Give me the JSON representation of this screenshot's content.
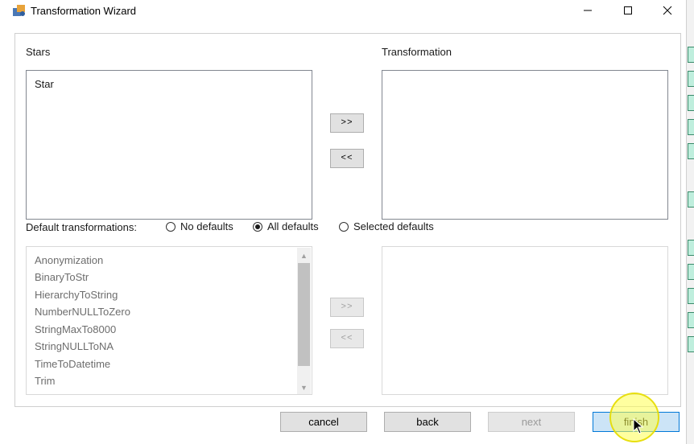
{
  "window": {
    "title": "Transformation Wizard"
  },
  "stars": {
    "label": "Stars",
    "items": [
      "Star"
    ]
  },
  "transformation": {
    "label": "Transformation",
    "items": []
  },
  "move_buttons": {
    "add": ">>",
    "remove": "<<"
  },
  "defaults": {
    "label": "Default transformations:",
    "options": [
      {
        "label": "No defaults",
        "selected": false
      },
      {
        "label": "All defaults",
        "selected": true
      },
      {
        "label": "Selected defaults",
        "selected": false
      }
    ],
    "available_items": [
      "Anonymization",
      "BinaryToStr",
      "HierarchyToString",
      "NumberNULLToZero",
      "StringMaxTo8000",
      "StringNULLToNA",
      "TimeToDatetime",
      "Trim"
    ]
  },
  "buttons": {
    "cancel": "cancel",
    "back": "back",
    "next": "next",
    "finish": "finish"
  },
  "colors": {
    "accent": "#0078d7",
    "primary_button_bg": "#cce4f7",
    "click_highlight": "#ffff50"
  },
  "icons": {
    "app": "wizard-app-icon",
    "minimize": "minimize-icon",
    "maximize": "maximize-icon",
    "close": "close-icon"
  }
}
